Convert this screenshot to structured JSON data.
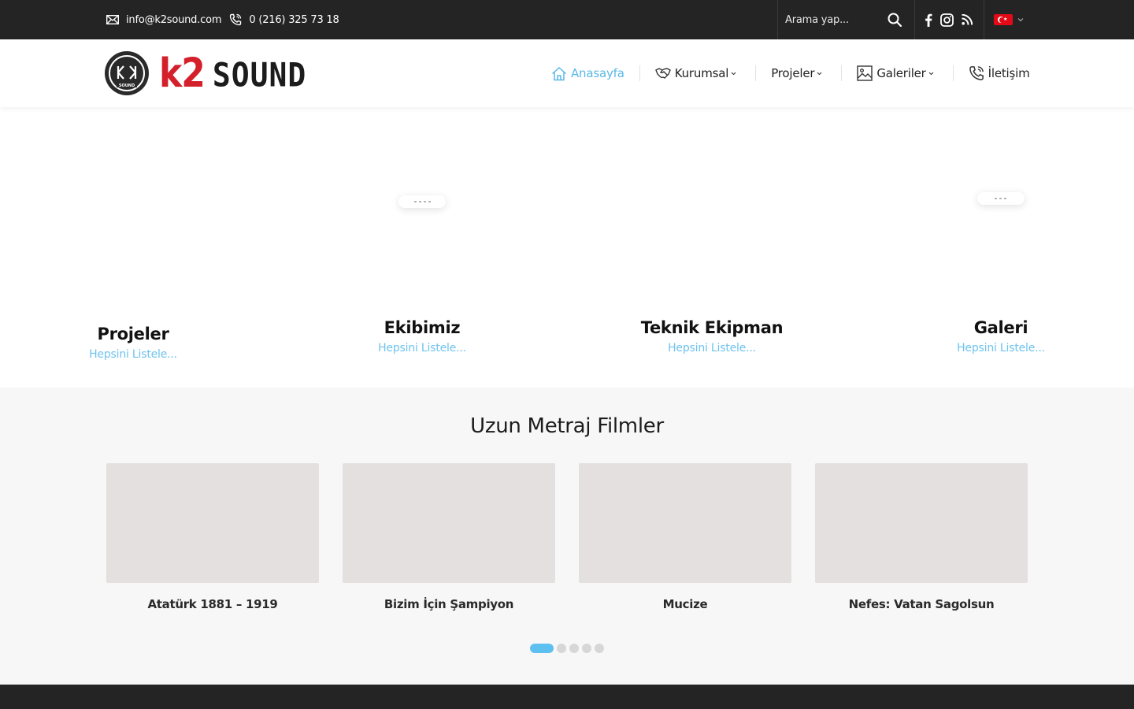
{
  "topbar": {
    "email": "info@k2sound.com",
    "phone": "0 (216) 325 73 18",
    "search_placeholder": "Arama yap...",
    "language": "tr"
  },
  "brand": {
    "logo_k2": "k2",
    "logo_sound": "SOUND",
    "badge_text": "K2 SOUND"
  },
  "nav": {
    "items": [
      {
        "label": "Anasayfa",
        "active": true,
        "dropdown": false,
        "icon": "home-icon"
      },
      {
        "label": "Kurumsal",
        "active": false,
        "dropdown": true,
        "icon": "handshake-icon"
      },
      {
        "label": "Projeler",
        "active": false,
        "dropdown": true,
        "icon": ""
      },
      {
        "label": "Galeriler",
        "active": false,
        "dropdown": true,
        "icon": "image-icon"
      },
      {
        "label": "İletişim",
        "active": false,
        "dropdown": false,
        "icon": "phone-icon"
      }
    ]
  },
  "features": [
    {
      "title": "Projeler",
      "link": "Hepsini Listele..."
    },
    {
      "title": "Ekibimiz",
      "link": "Hepsini Listele..."
    },
    {
      "title": "Teknik Ekipman",
      "link": "Hepsini Listele..."
    },
    {
      "title": "Galeri",
      "link": "Hepsini Listele..."
    }
  ],
  "films": {
    "heading": "Uzun Metraj Filmler",
    "items": [
      {
        "title": "Atatürk 1881 – 1919"
      },
      {
        "title": "Bizim İçin Şampiyon"
      },
      {
        "title": "Mucize"
      },
      {
        "title": "Nefes: Vatan Sagolsun"
      }
    ],
    "pager_count": 5,
    "pager_active": 1
  },
  "colors": {
    "accent": "#5ab8e8",
    "dark": "#242424",
    "brand_red": "#d4202b"
  }
}
